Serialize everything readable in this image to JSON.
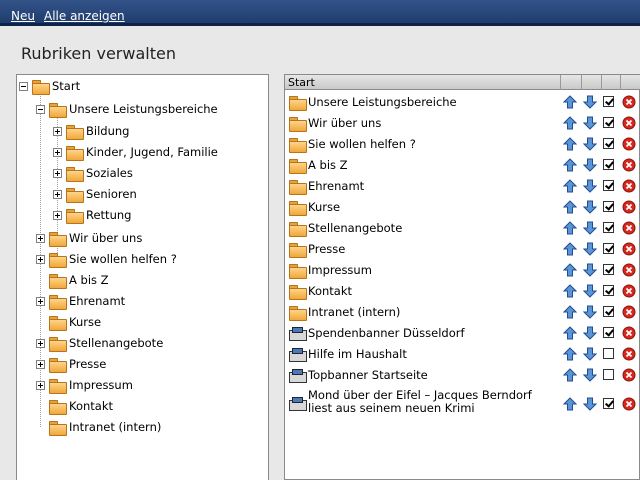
{
  "menu": {
    "new_label": "Neu",
    "show_all_label": "Alle anzeigen"
  },
  "page": {
    "title": "Rubriken verwalten"
  },
  "tree": {
    "root": "Start",
    "items": [
      "Unsere Leistungsbereiche",
      "Bildung",
      "Kinder, Jugend, Familie",
      "Soziales",
      "Senioren",
      "Rettung",
      "Wir über uns",
      "Sie wollen helfen ?",
      "A bis Z",
      "Ehrenamt",
      "Kurse",
      "Stellenangebote",
      "Presse",
      "Impressum",
      "Kontakt",
      "Intranet (intern)"
    ]
  },
  "table": {
    "header": "Start",
    "rows": [
      {
        "label": "Unsere Leistungsbereiche",
        "icon": "folder-icon",
        "active": true
      },
      {
        "label": "Wir über uns",
        "icon": "folder-icon",
        "active": true
      },
      {
        "label": "Sie wollen helfen ?",
        "icon": "folder-icon",
        "active": true
      },
      {
        "label": "A bis Z",
        "icon": "folder-icon",
        "active": true
      },
      {
        "label": "Ehrenamt",
        "icon": "folder-icon",
        "active": true
      },
      {
        "label": "Kurse",
        "icon": "folder-icon",
        "active": true
      },
      {
        "label": "Stellenangebote",
        "icon": "folder-icon",
        "active": true
      },
      {
        "label": "Presse",
        "icon": "folder-icon",
        "active": true
      },
      {
        "label": "Impressum",
        "icon": "folder-icon",
        "active": true
      },
      {
        "label": "Kontakt",
        "icon": "folder-icon",
        "active": true
      },
      {
        "label": "Intranet (intern)",
        "icon": "folder-icon",
        "active": true
      },
      {
        "label": "Spendenbanner Düsseldorf",
        "icon": "banner-icon",
        "active": true
      },
      {
        "label": "Hilfe im Haushalt",
        "icon": "banner-icon",
        "active": false
      },
      {
        "label": "Topbanner Startseite",
        "icon": "banner-icon",
        "active": false
      },
      {
        "label_line1": "Mond über der Eifel – Jacques Berndorf",
        "label_line2": "liest aus seinem neuen Krimi",
        "icon": "banner-icon",
        "active": true
      }
    ]
  },
  "colors": {
    "menubar": "#1f3c6d",
    "arrow_blue": "#3a78c8",
    "delete_red": "#d8281e",
    "folder_orange": "#f0a83a"
  }
}
